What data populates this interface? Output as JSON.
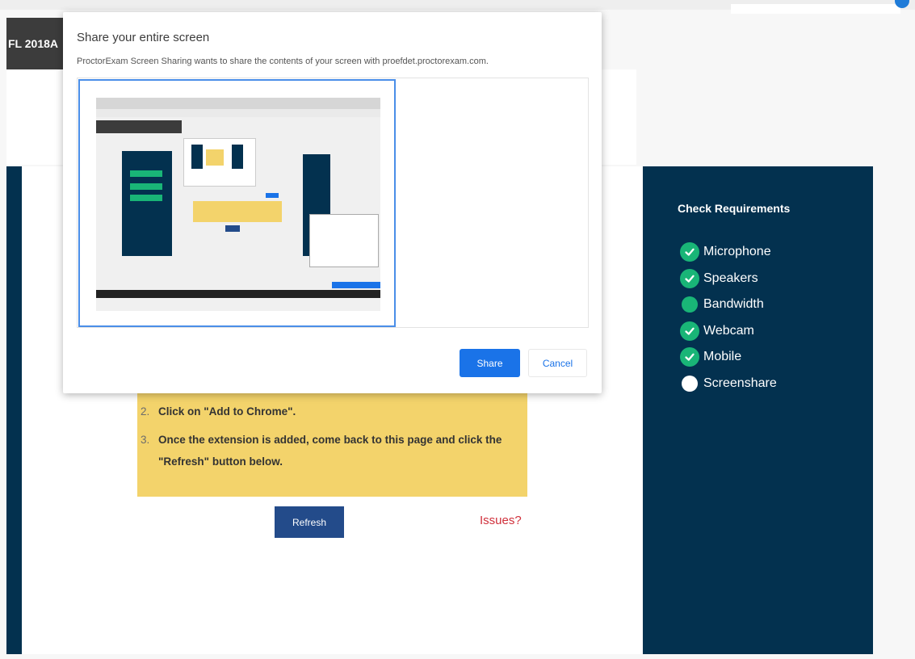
{
  "header": {
    "brand_text": "FL 2018A"
  },
  "share_dialog": {
    "title": "Share your entire screen",
    "subtitle": "ProctorExam Screen Sharing wants to share the contents of your screen with proefdet.proctorexam.com.",
    "share_label": "Share",
    "cancel_label": "Cancel"
  },
  "instructions": {
    "steps": [
      {
        "number": "2.",
        "text": "Click on \"Add to Chrome\"."
      },
      {
        "number": "3.",
        "text": "Once the extension is added, come back to this page and click the \"Refresh\" button below."
      }
    ]
  },
  "actions": {
    "refresh_label": "Refresh",
    "issues_label": "Issues?"
  },
  "requirements": {
    "title": "Check Requirements",
    "items": [
      {
        "label": "Microphone",
        "status": "passed",
        "icon": "check-circle-icon"
      },
      {
        "label": "Speakers",
        "status": "passed",
        "icon": "check-circle-icon"
      },
      {
        "label": "Bandwidth",
        "status": "in-progress",
        "icon": "status-dot-icon"
      },
      {
        "label": "Webcam",
        "status": "passed",
        "icon": "check-circle-icon"
      },
      {
        "label": "Mobile",
        "status": "passed",
        "icon": "check-circle-icon"
      },
      {
        "label": "Screenshare",
        "status": "pending",
        "icon": "status-dot-icon"
      }
    ]
  },
  "colors": {
    "panel_navy": "#03314f",
    "check_green": "#19b577",
    "instructions_yellow": "#f3d36b",
    "refresh_blue": "#234b8a",
    "issues_red": "#d0303b",
    "dialog_primary_blue": "#1a73e8"
  }
}
